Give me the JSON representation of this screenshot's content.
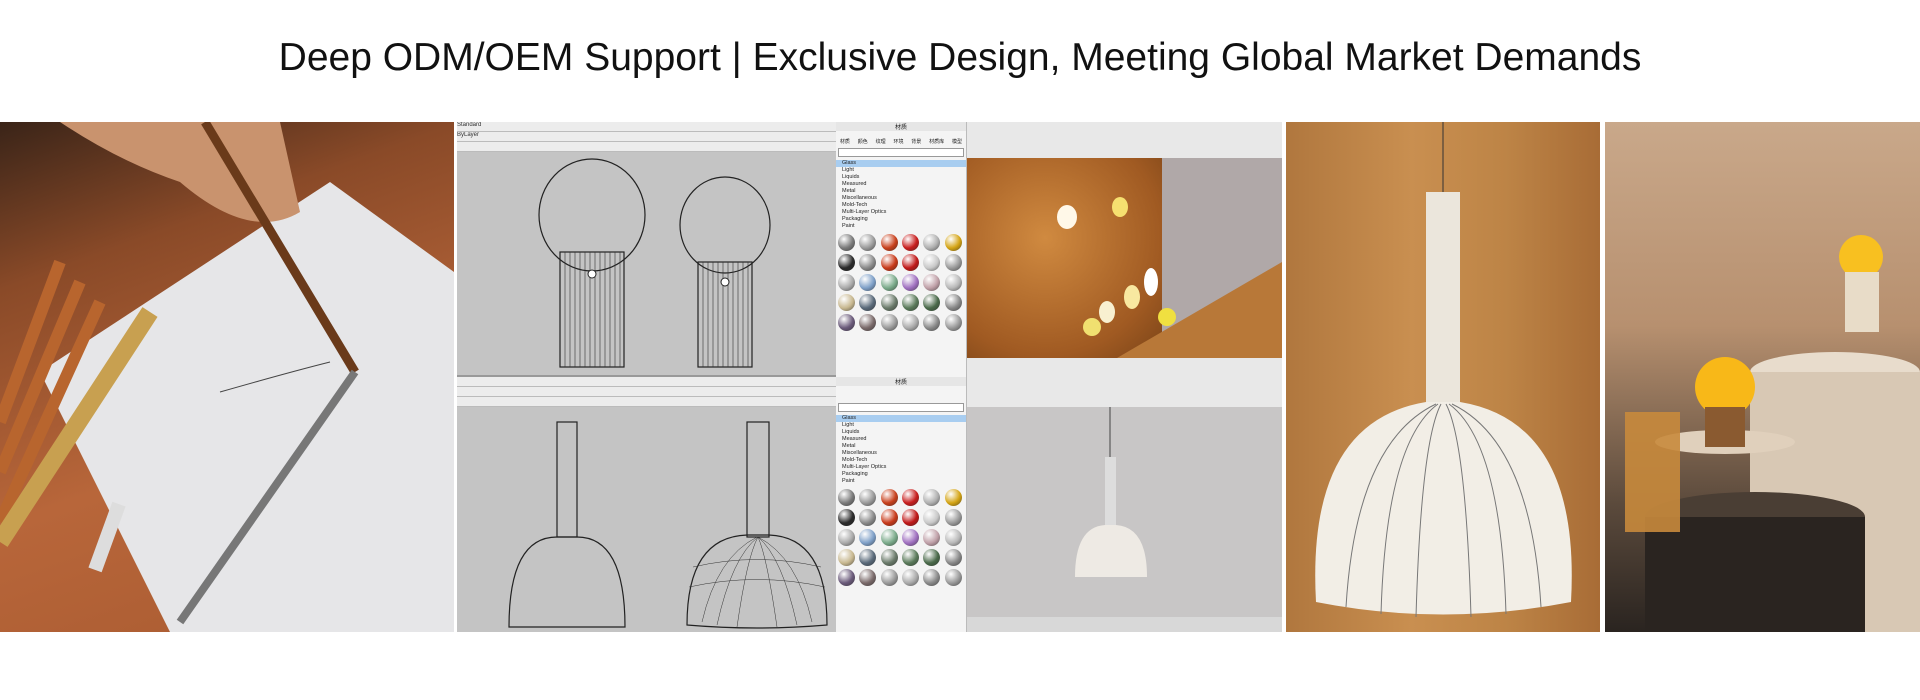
{
  "title": "Deep ODM/OEM Support | Exclusive Design, Meeting Global Market Demands",
  "materials_panel": {
    "header": "材质",
    "tabs": [
      "材质",
      "颜色",
      "纹理",
      "环境",
      "背景",
      "材质库",
      "模型"
    ],
    "categories": [
      "Glass",
      "Light",
      "Liquids",
      "Measured",
      "Metal",
      "Miscellaneous",
      "Mold-Tech",
      "Multi-Layer Optics",
      "Packaging",
      "Paint"
    ],
    "selected": "Glass",
    "swatch_colors": [
      "#7a7a7a",
      "#9a9a9a",
      "#c8401c",
      "#c81e1e",
      "#b0b0b0",
      "#d4a414",
      "#2a2a2a",
      "#8a8a8a",
      "#c83a1a",
      "#c01818",
      "#c8c8c8",
      "#9a9a9a",
      "#aaaaaa",
      "#7fa0c8",
      "#7aaa8a",
      "#a070c0",
      "#c0a0a8",
      "#b8b8b8",
      "#c8b890",
      "#5a6a7a",
      "#6a7a6a",
      "#5a7a5a",
      "#4a6a4a",
      "#888888",
      "#6a5a7a",
      "#7a6a6a",
      "#9a9a9a",
      "#aaaaaa",
      "#8a8a8a",
      "#999999"
    ]
  },
  "cad_toolbar": {
    "layer": "ByLayer",
    "style": "Standard"
  }
}
